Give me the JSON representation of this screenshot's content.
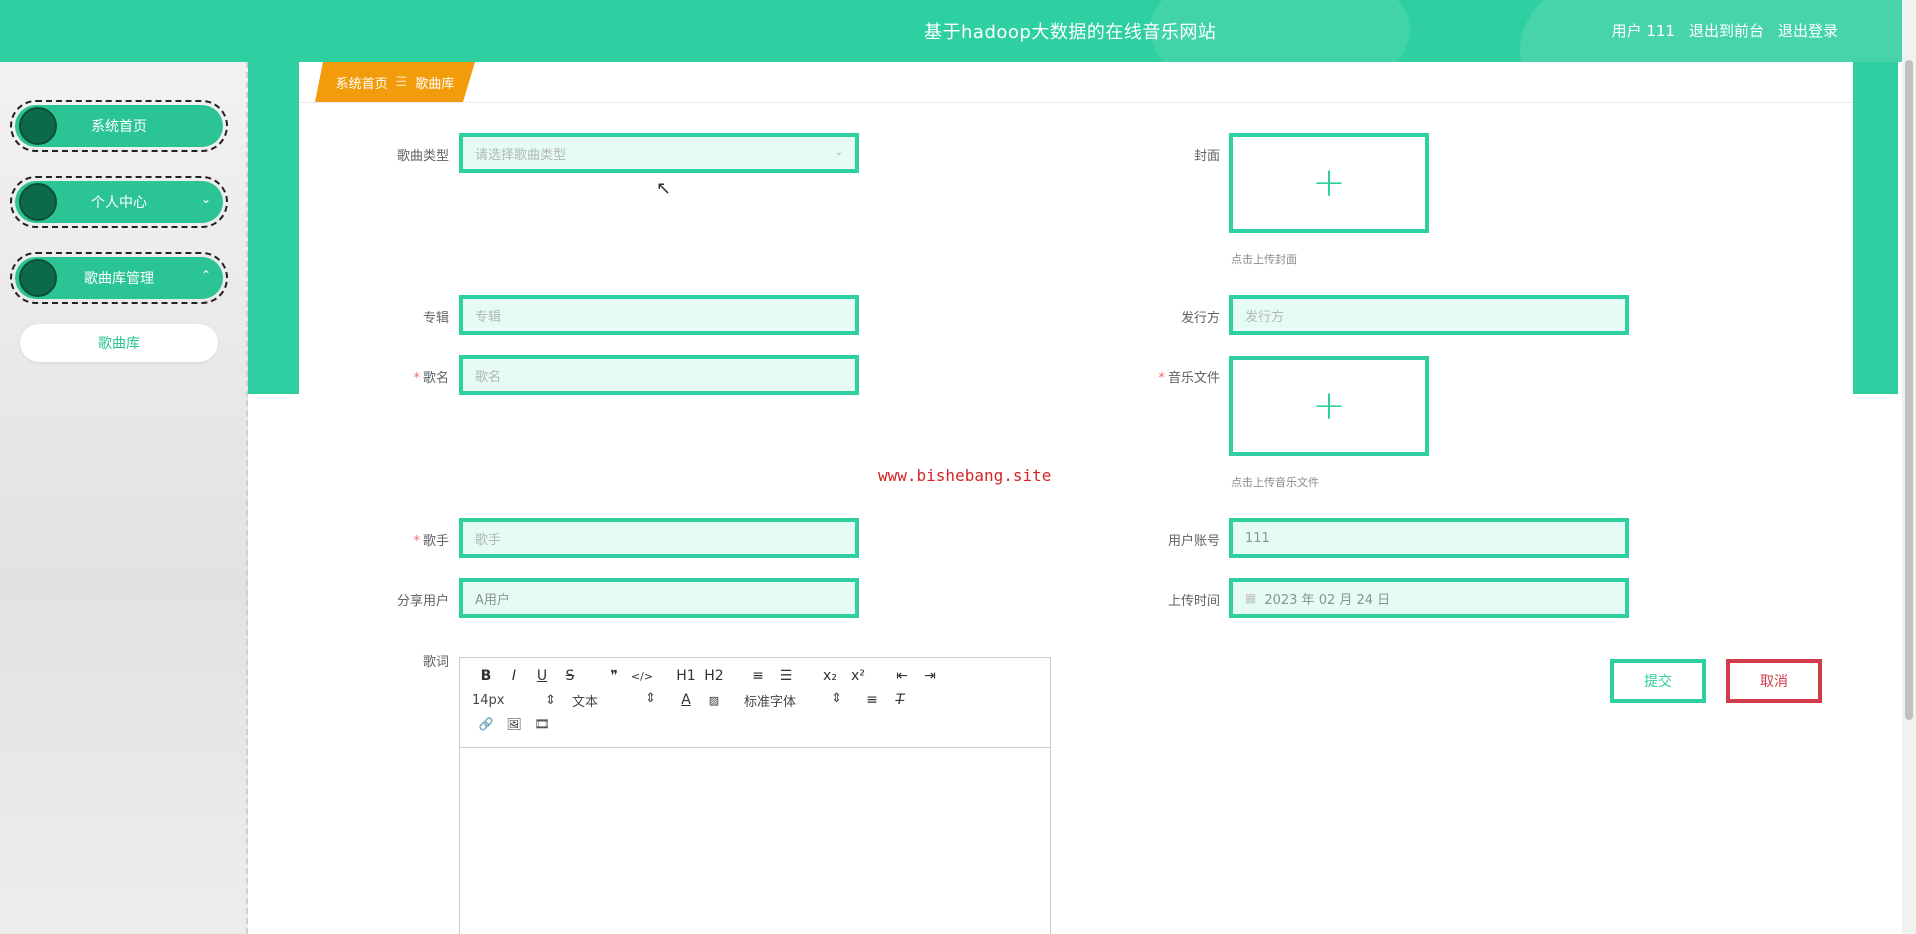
{
  "header": {
    "title": "基于hadoop大数据的在线音乐网站",
    "user_label": "用户 111",
    "to_backend": "退出到前台",
    "logout": "退出登录"
  },
  "sidebar": {
    "items": [
      {
        "label": "系统首页"
      },
      {
        "label": "个人中心",
        "caret": "⌄"
      },
      {
        "label": "歌曲库管理",
        "caret": "⌃"
      }
    ],
    "submenu": {
      "label": "歌曲库"
    }
  },
  "breadcrumb": {
    "home": "系统首页",
    "separator": "☰",
    "current": "歌曲库"
  },
  "form": {
    "song_type": {
      "label": "歌曲类型",
      "placeholder": "请选择歌曲类型"
    },
    "cover": {
      "label": "封面",
      "hint": "点击上传封面"
    },
    "album": {
      "label": "专辑",
      "placeholder": "专辑"
    },
    "publisher": {
      "label": "发行方",
      "placeholder": "发行方"
    },
    "song_name": {
      "label": "歌名",
      "placeholder": "歌名"
    },
    "music_file": {
      "label": "音乐文件",
      "hint": "点击上传音乐文件"
    },
    "singer": {
      "label": "歌手",
      "placeholder": "歌手"
    },
    "user_account": {
      "label": "用户账号",
      "value": "111"
    },
    "share_user": {
      "label": "分享用户",
      "value": "A用户"
    },
    "upload_time": {
      "label": "上传时间",
      "value": "2023 年 02 月 24 日"
    },
    "lyrics": {
      "label": "歌词"
    },
    "required_mark": "*"
  },
  "editor_toolbar": {
    "row1": [
      "B",
      "I",
      "U",
      "S",
      "❞",
      "</>",
      "H1",
      "H2",
      "≡",
      "☰",
      "x₂",
      "x²",
      "⇤",
      "⇥"
    ],
    "font_size": "14px",
    "text_style": "文本",
    "font_family": "标准字体",
    "row3": [
      "🔗",
      "🖼",
      "🎞"
    ]
  },
  "actions": {
    "submit": "提交",
    "cancel": "取消"
  },
  "watermark": "www.bishebang.site",
  "colors": {
    "primary": "#2ecfa0",
    "accent_orange": "#f29b0b",
    "danger": "#d23b4b"
  }
}
